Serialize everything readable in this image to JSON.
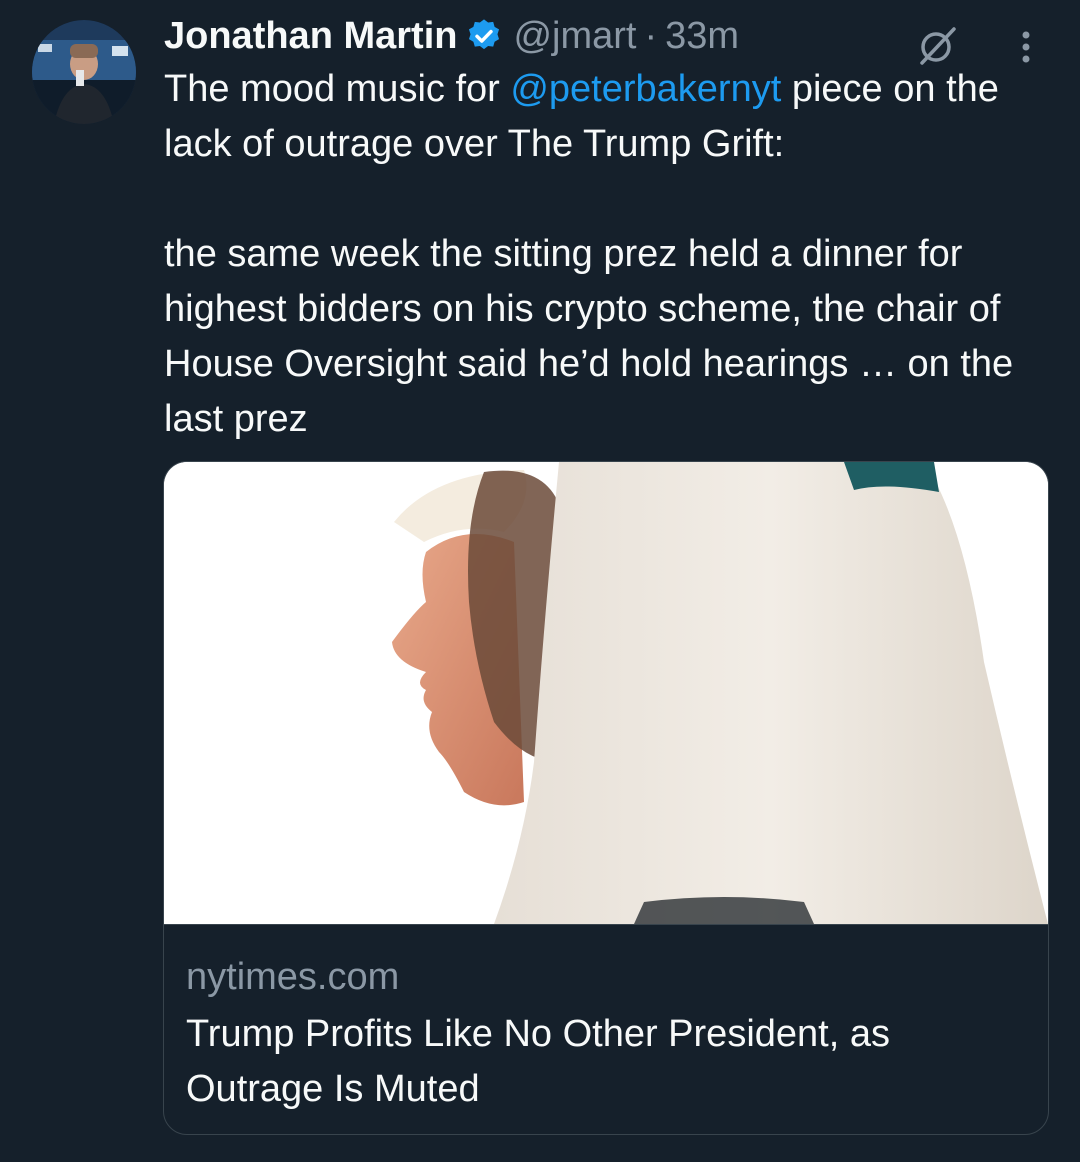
{
  "author": {
    "name": "Jonathan Martin",
    "handle": "@jmart",
    "separator": "·",
    "time": "33m",
    "verified_icon": "verified-badge-icon"
  },
  "tweet": {
    "line1_before": "The mood music for ",
    "mention": "@peterbakernyt",
    "line1_after": " piece on the lack of outrage over The Trump Grift:",
    "paragraph2": "the same week the sitting prez held a dinner for highest bidders on his crypto scheme, the chair of House Oversight said he’d hold hearings … on the last prez"
  },
  "card": {
    "domain": "nytimes.com",
    "headline": "Trump Profits Like No Other President, as Outrage Is Muted"
  },
  "colors": {
    "background": "#15202b",
    "text": "#f7f9f9",
    "secondary": "#8b98a5",
    "link": "#1d9bf0",
    "border": "#38444d"
  }
}
